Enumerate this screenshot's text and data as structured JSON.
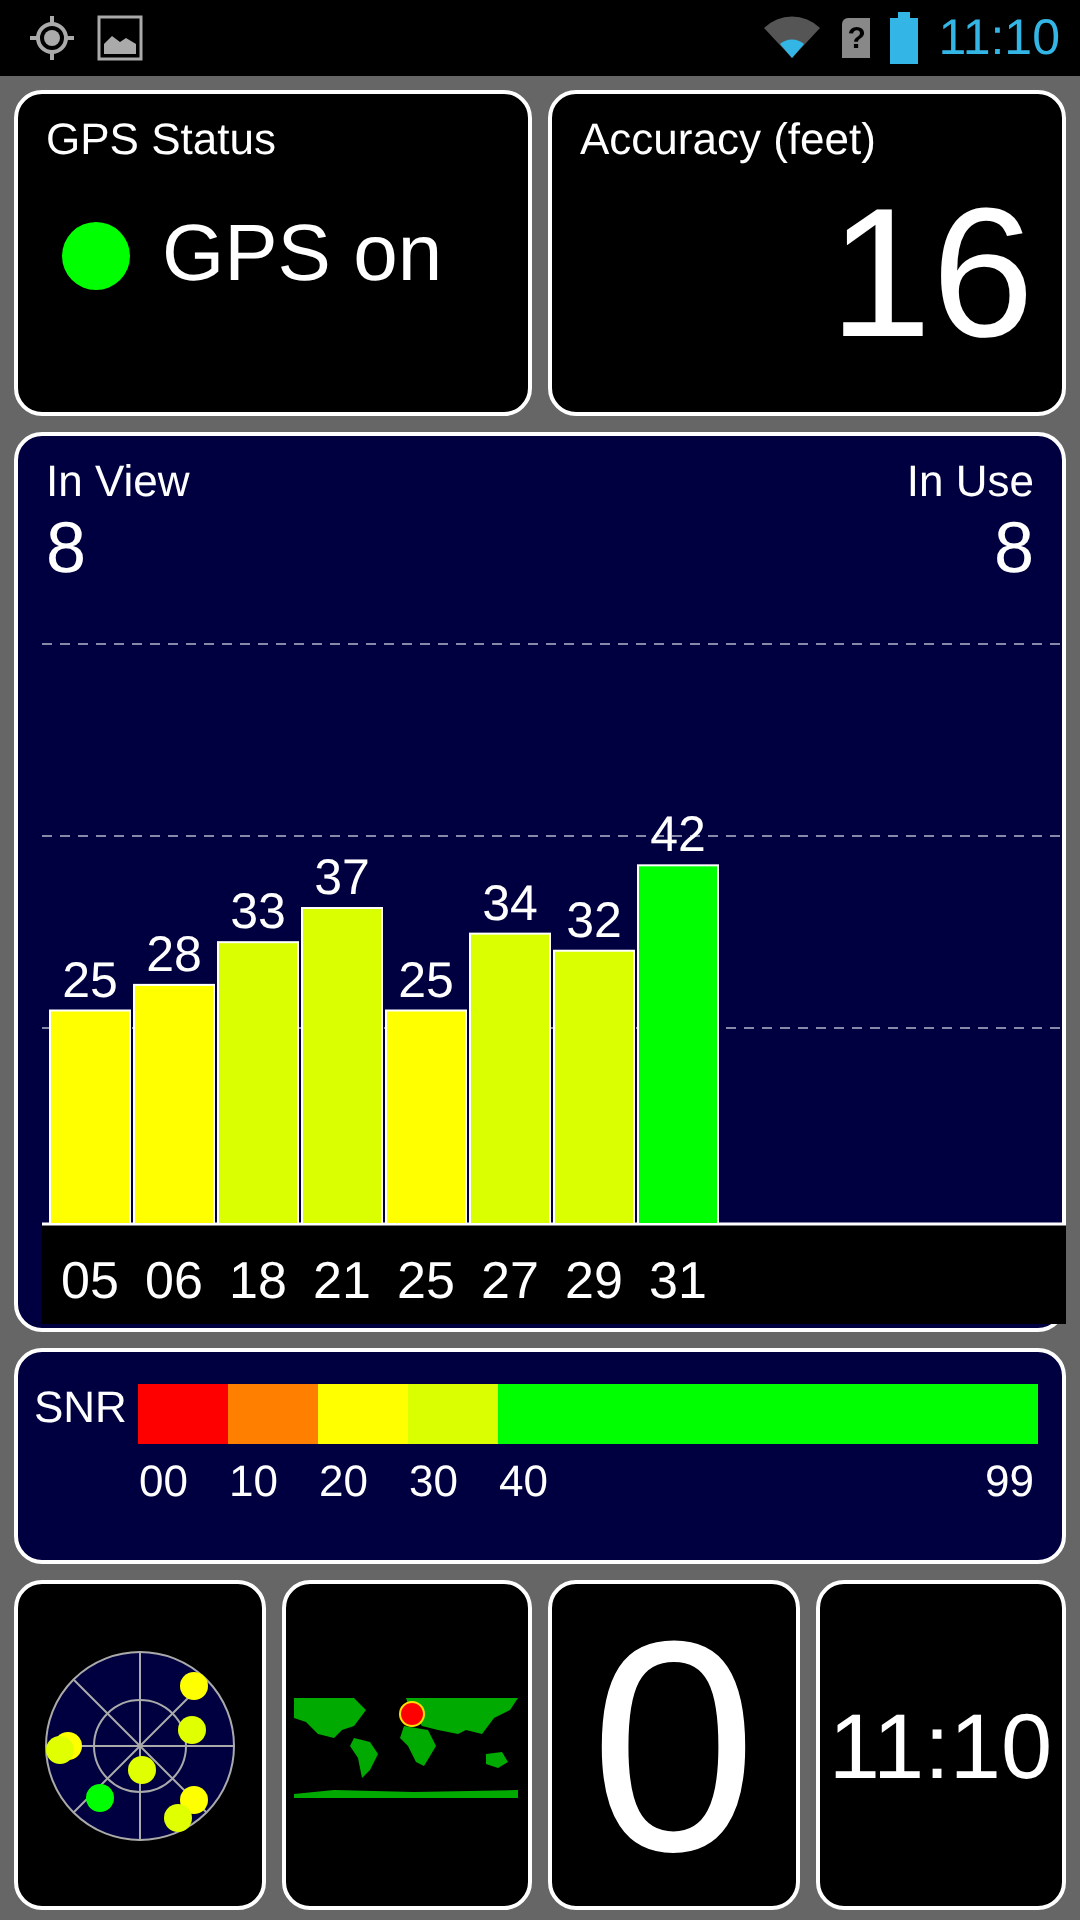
{
  "status_bar": {
    "sim_status": "?",
    "time": "11:10"
  },
  "gps_status": {
    "title": "GPS Status",
    "text": "GPS on",
    "on": true
  },
  "accuracy": {
    "title": "Accuracy (feet)",
    "value": "16"
  },
  "satellites": {
    "in_view_label": "In View",
    "in_view": "8",
    "in_use_label": "In Use",
    "in_use": "8",
    "chart_data": {
      "type": "bar",
      "categories": [
        "05",
        "06",
        "18",
        "21",
        "25",
        "27",
        "29",
        "31"
      ],
      "values": [
        25,
        28,
        33,
        37,
        25,
        34,
        32,
        42
      ],
      "data_labels": true
    }
  },
  "snr_legend": {
    "label": "SNR",
    "segments": [
      {
        "label": "00",
        "color": "#ff0000"
      },
      {
        "label": "10",
        "color": "#ff8000"
      },
      {
        "label": "20",
        "color": "#ffff00"
      },
      {
        "label": "30",
        "color": "#d9ff00"
      },
      {
        "label": "40",
        "color": "#00ff00"
      }
    ],
    "end_label": "99"
  },
  "satellite_count": {
    "value": "0"
  },
  "clock": {
    "time": "11:10"
  }
}
